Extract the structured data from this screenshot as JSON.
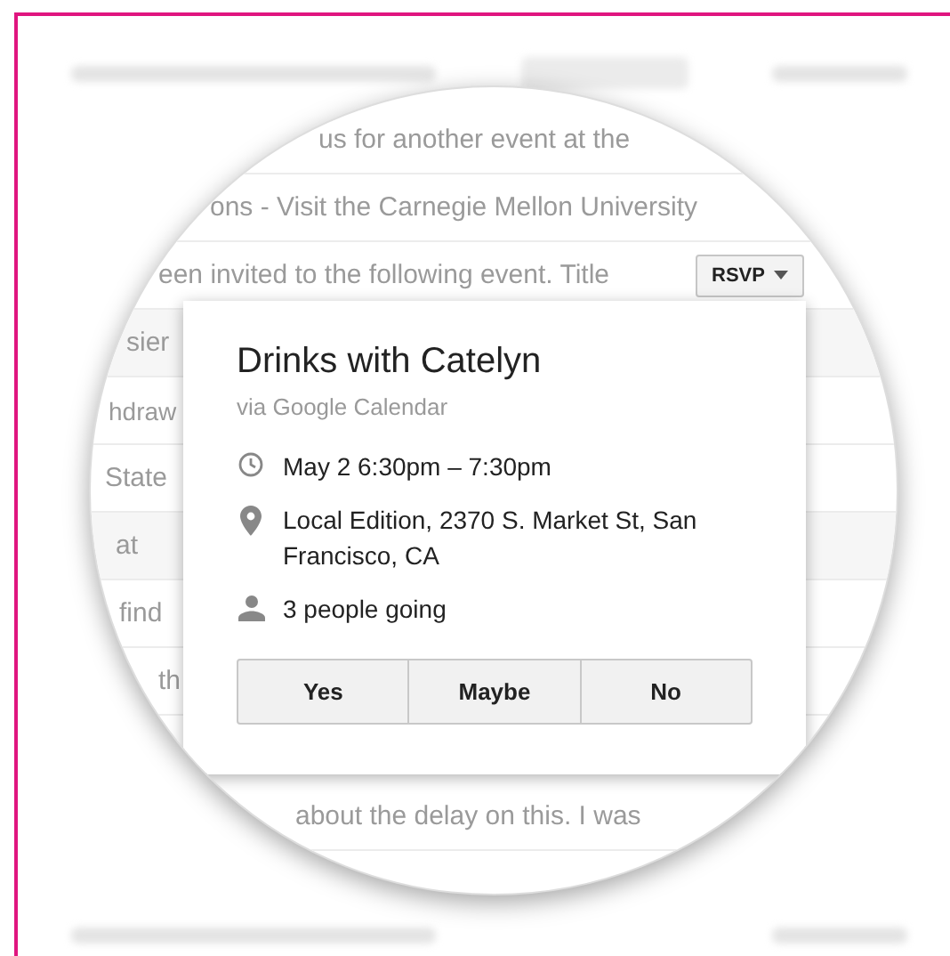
{
  "email_rows": [
    {
      "text": "us for another event at the"
    },
    {
      "text": "ons - Visit the Carnegie Mellon University"
    },
    {
      "text": "een invited to the following event. Title",
      "button": "RSVP"
    },
    {
      "text": "sier"
    },
    {
      "text": "hdraw"
    },
    {
      "text": "State"
    },
    {
      "text": "at"
    },
    {
      "text": "find"
    },
    {
      "text": "th"
    },
    {
      "text": "about the delay on this. I was"
    }
  ],
  "event_card": {
    "title": "Drinks with Catelyn",
    "source": "via Google Calendar",
    "details": [
      {
        "kind": "time",
        "text": "May 2 6:30pm – 7:30pm"
      },
      {
        "kind": "location",
        "text": "Local Edition, 2370 S. Market St, San Francisco, CA"
      },
      {
        "kind": "guests",
        "text": "3 people going"
      }
    ],
    "responses": [
      "Yes",
      "Maybe",
      "No"
    ]
  }
}
